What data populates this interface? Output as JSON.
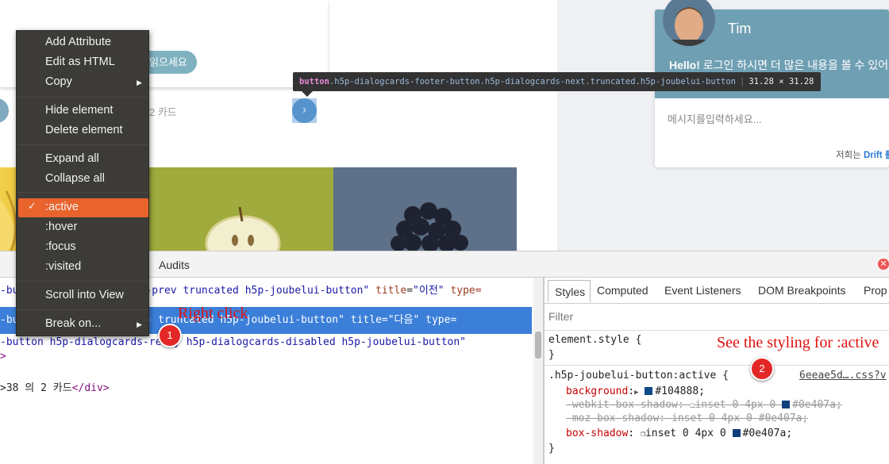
{
  "page": {
    "try_again_label": "읽으세요",
    "progress_text": "2 카드",
    "next_arrow": "›"
  },
  "tooltip": {
    "tag": "button",
    "classes": ".h5p-dialogcards-footer-button.h5p-dialogcards-next.truncated.h5p-joubelui-button",
    "size": "31.28 × 31.28"
  },
  "chat": {
    "name": "Tim",
    "hello_bold": "Hello!",
    "hello_text": " 로그인 하시면 더 많은 내용을 볼 수 있어",
    "input_placeholder": "메시지를입력하세요...",
    "powered_prefix": "저희는 ",
    "powered_link": "Drift 를"
  },
  "devtools": {
    "tab_audits": "Audits",
    "close_icon": "✕",
    "elements": {
      "line1": {
        "pre": "-bu",
        "gap": "-prev truncated h5p-joubelui-button\"",
        "attr": "title",
        "val": "\"이전\"",
        "tail": "type="
      },
      "line2": {
        "pre": "-bu",
        "gap": "- truncated h5p-joubelui-button\"",
        "attr": "title",
        "val": "\"다음\"",
        "tail": "type="
      },
      "line3": "-button h5p-dialogcards-retry h5p-dialogcards-disabled h5p-joubelui-button\"",
      "line4": ">",
      "line5_text": ">38 의 2 카드",
      "line5_tag": "</div>"
    },
    "styles_tabs": [
      "Styles",
      "Computed",
      "Event Listeners",
      "DOM Breakpoints",
      "Prop"
    ],
    "filter_placeholder": "Filter",
    "element_style": {
      "selector": "element.style {",
      "close": "}"
    },
    "rule": {
      "selector": ".h5p-joubelui-button:active {",
      "source": "6eeae5d….css?v",
      "decls": [
        {
          "prop": "background",
          "arrow": "▶",
          "color": "#104888",
          "value": "#104888;"
        },
        {
          "prop": "-webkit-box-shadow",
          "color": "#0e407a",
          "value": "inset 0 4px 0 ",
          "value2": "#0e407a;"
        },
        {
          "prop": "-moz-box-shadow",
          "value": "inset 0 4px 0 #0e407a;"
        },
        {
          "prop": "box-shadow",
          "color": "#0e407a",
          "value": "inset 0 4px 0 ",
          "value2": "#0e407a;"
        }
      ],
      "close": "}"
    }
  },
  "context_menu": {
    "items": [
      "Add Attribute",
      "Edit as HTML",
      "Copy",
      "Hide element",
      "Delete element",
      "Expand all",
      "Collapse all",
      ":active",
      ":hover",
      ":focus",
      ":visited",
      "Scroll into View",
      "Break on..."
    ],
    "check": "✓",
    "submenu_arrow": "▶"
  },
  "annotations": {
    "badge1": "1",
    "badge2": "2",
    "right_click": "Right click",
    "see_styling": "See the styling for :active"
  },
  "colors": {
    "active_bg": "#104888",
    "shadow": "#0e407a",
    "menu_highlight": "#e8642c",
    "annotation_red": "#e01010"
  }
}
